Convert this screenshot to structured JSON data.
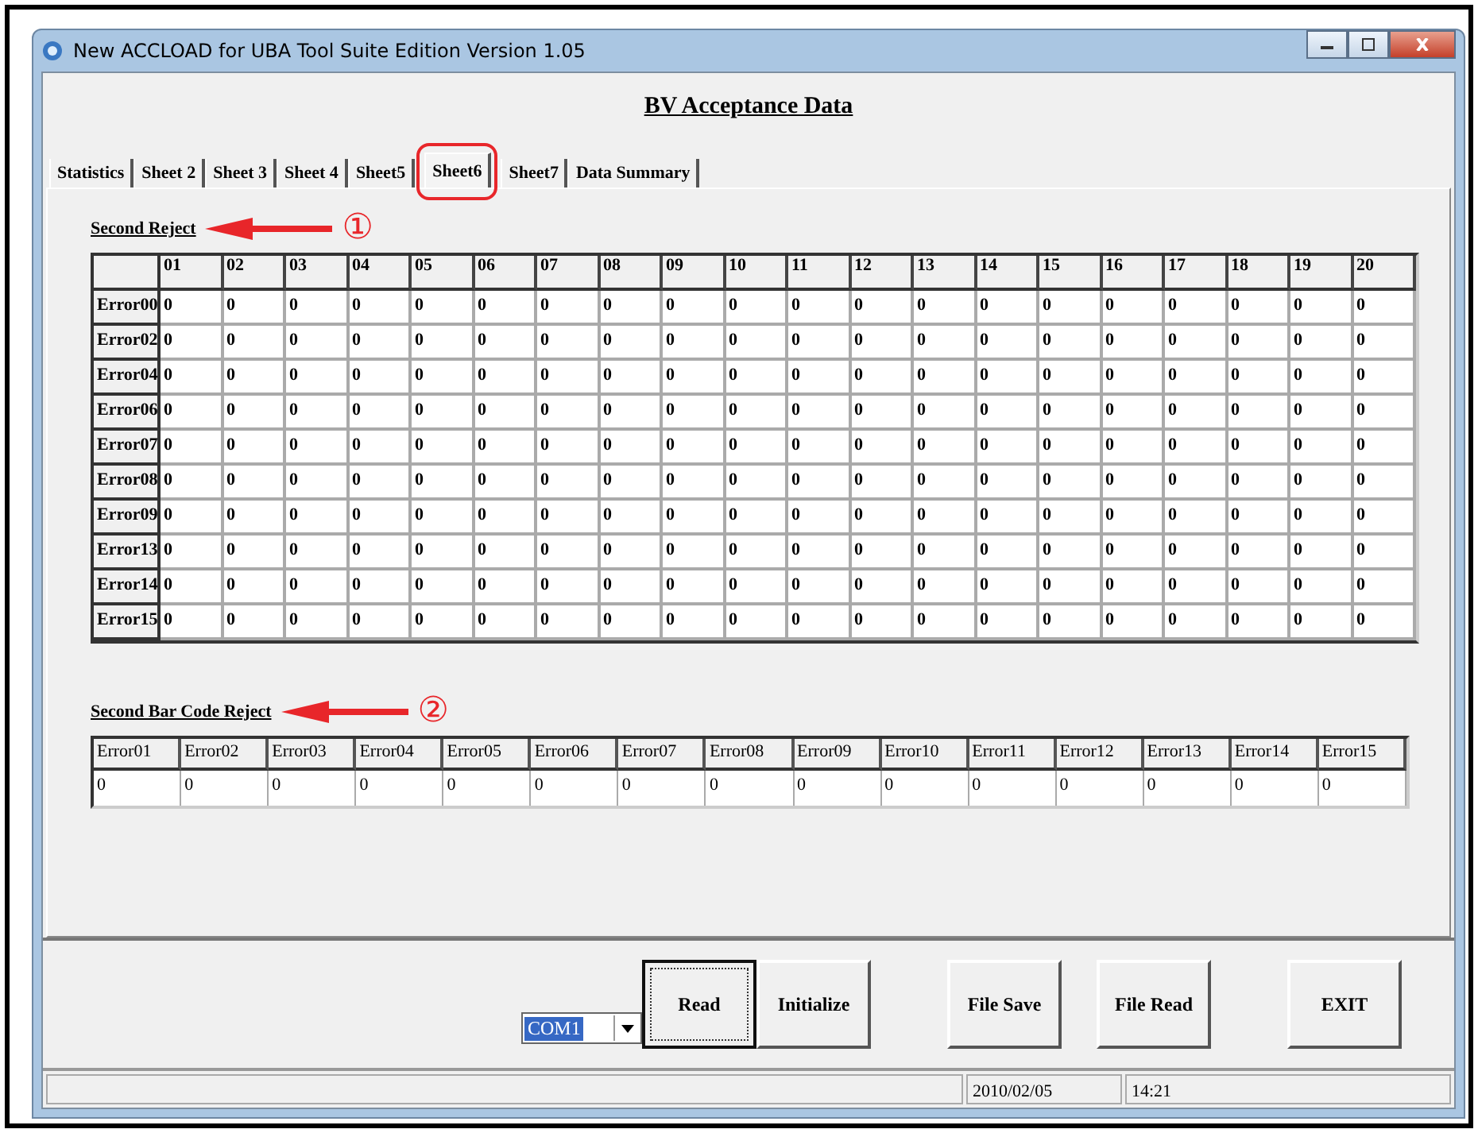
{
  "window": {
    "title": "New ACCLOAD for UBA Tool Suite Edition Version 1.05"
  },
  "heading": "BV Acceptance Data",
  "tabs": [
    {
      "label": "Statistics",
      "selected": false
    },
    {
      "label": "Sheet 2",
      "selected": false
    },
    {
      "label": "Sheet 3",
      "selected": false
    },
    {
      "label": "Sheet 4",
      "selected": false
    },
    {
      "label": "Sheet5",
      "selected": false
    },
    {
      "label": "Sheet6",
      "selected": true
    },
    {
      "label": "Sheet7",
      "selected": false
    },
    {
      "label": "Data Summary",
      "selected": false
    }
  ],
  "second_reject": {
    "title": "Second Reject",
    "callout": "①",
    "columns": [
      "01",
      "02",
      "03",
      "04",
      "05",
      "06",
      "07",
      "08",
      "09",
      "10",
      "11",
      "12",
      "13",
      "14",
      "15",
      "16",
      "17",
      "18",
      "19",
      "20"
    ],
    "rows": [
      {
        "label": "Error00",
        "cells": [
          "0",
          "0",
          "0",
          "0",
          "0",
          "0",
          "0",
          "0",
          "0",
          "0",
          "0",
          "0",
          "0",
          "0",
          "0",
          "0",
          "0",
          "0",
          "0",
          "0"
        ]
      },
      {
        "label": "Error02",
        "cells": [
          "0",
          "0",
          "0",
          "0",
          "0",
          "0",
          "0",
          "0",
          "0",
          "0",
          "0",
          "0",
          "0",
          "0",
          "0",
          "0",
          "0",
          "0",
          "0",
          "0"
        ]
      },
      {
        "label": "Error04",
        "cells": [
          "0",
          "0",
          "0",
          "0",
          "0",
          "0",
          "0",
          "0",
          "0",
          "0",
          "0",
          "0",
          "0",
          "0",
          "0",
          "0",
          "0",
          "0",
          "0",
          "0"
        ]
      },
      {
        "label": "Error06",
        "cells": [
          "0",
          "0",
          "0",
          "0",
          "0",
          "0",
          "0",
          "0",
          "0",
          "0",
          "0",
          "0",
          "0",
          "0",
          "0",
          "0",
          "0",
          "0",
          "0",
          "0"
        ]
      },
      {
        "label": "Error07",
        "cells": [
          "0",
          "0",
          "0",
          "0",
          "0",
          "0",
          "0",
          "0",
          "0",
          "0",
          "0",
          "0",
          "0",
          "0",
          "0",
          "0",
          "0",
          "0",
          "0",
          "0"
        ]
      },
      {
        "label": "Error08",
        "cells": [
          "0",
          "0",
          "0",
          "0",
          "0",
          "0",
          "0",
          "0",
          "0",
          "0",
          "0",
          "0",
          "0",
          "0",
          "0",
          "0",
          "0",
          "0",
          "0",
          "0"
        ]
      },
      {
        "label": "Error09",
        "cells": [
          "0",
          "0",
          "0",
          "0",
          "0",
          "0",
          "0",
          "0",
          "0",
          "0",
          "0",
          "0",
          "0",
          "0",
          "0",
          "0",
          "0",
          "0",
          "0",
          "0"
        ]
      },
      {
        "label": "Error13",
        "cells": [
          "0",
          "0",
          "0",
          "0",
          "0",
          "0",
          "0",
          "0",
          "0",
          "0",
          "0",
          "0",
          "0",
          "0",
          "0",
          "0",
          "0",
          "0",
          "0",
          "0"
        ]
      },
      {
        "label": "Error14",
        "cells": [
          "0",
          "0",
          "0",
          "0",
          "0",
          "0",
          "0",
          "0",
          "0",
          "0",
          "0",
          "0",
          "0",
          "0",
          "0",
          "0",
          "0",
          "0",
          "0",
          "0"
        ]
      },
      {
        "label": "Error15",
        "cells": [
          "0",
          "0",
          "0",
          "0",
          "0",
          "0",
          "0",
          "0",
          "0",
          "0",
          "0",
          "0",
          "0",
          "0",
          "0",
          "0",
          "0",
          "0",
          "0",
          "0"
        ]
      }
    ]
  },
  "second_bar_code_reject": {
    "title": "Second Bar Code Reject",
    "callout": "②",
    "columns": [
      "Error01",
      "Error02",
      "Error03",
      "Error04",
      "Error05",
      "Error06",
      "Error07",
      "Error08",
      "Error09",
      "Error10",
      "Error11",
      "Error12",
      "Error13",
      "Error14",
      "Error15"
    ],
    "values": [
      "0",
      "0",
      "0",
      "0",
      "0",
      "0",
      "0",
      "0",
      "0",
      "0",
      "0",
      "0",
      "0",
      "0",
      "0"
    ]
  },
  "port": {
    "value": "COM1"
  },
  "buttons": [
    {
      "label": "Read",
      "focused": true
    },
    {
      "label": "Initialize",
      "focused": false
    },
    {
      "label": "File Save",
      "focused": false
    },
    {
      "label": "File Read",
      "focused": false
    },
    {
      "label": "EXIT",
      "focused": false
    }
  ],
  "status_bar": {
    "date": "2010/02/05",
    "time": "14:21"
  }
}
